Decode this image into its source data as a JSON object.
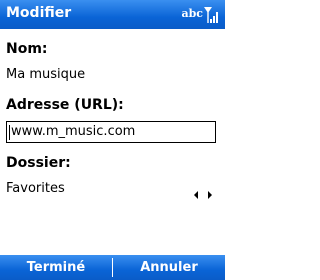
{
  "header": {
    "title": "Modifier",
    "input_mode": "abc",
    "signal_icon": "signal-strength-icon"
  },
  "form": {
    "name_label": "Nom:",
    "name_value": "Ma musique",
    "url_label": "Adresse (URL):",
    "url_value": "www.m_music.com",
    "folder_label": "Dossier:",
    "folder_value": "Favorites",
    "folder_spinner_icon": "left-right-arrows-icon"
  },
  "softkeys": {
    "left_label": "Terminé",
    "right_label": "Annuler"
  },
  "colors": {
    "bar": "#0a64d6",
    "bar_text": "#ffffff",
    "background": "#ffffff"
  }
}
